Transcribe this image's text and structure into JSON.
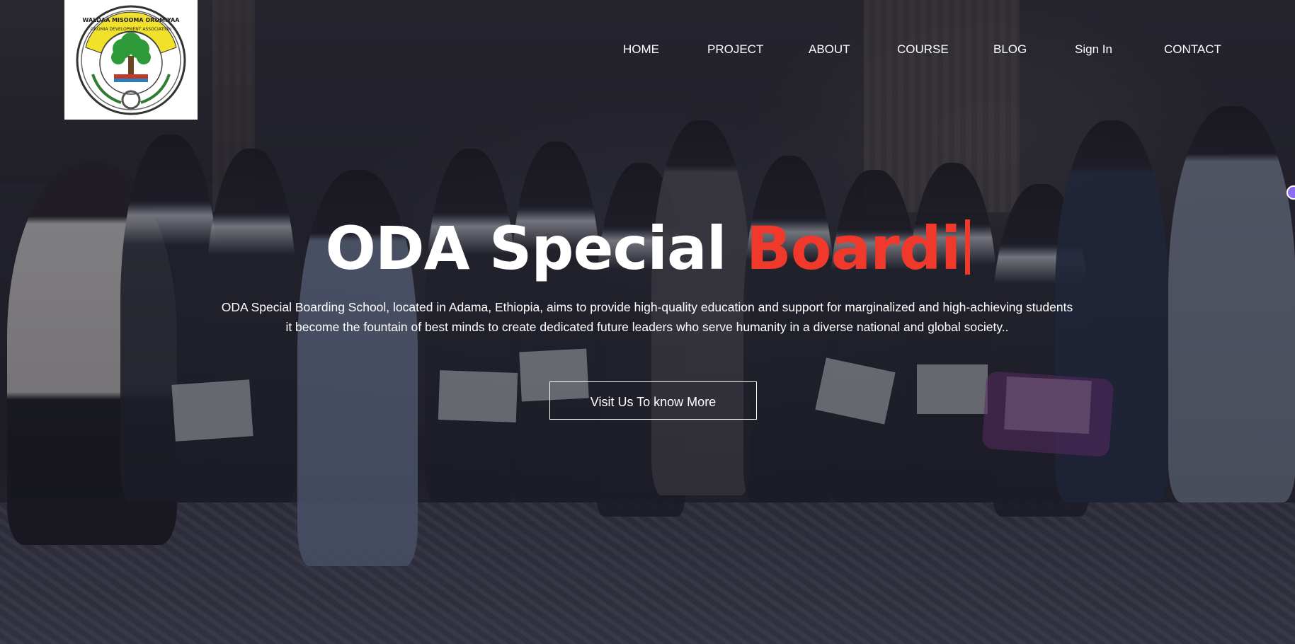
{
  "brand": {
    "logo_icon": "organization-emblem-icon",
    "logo_text_top": "WALDAA MISOOMA OROMIYAA",
    "logo_text_sub": "OROMIA DEVELOPMENT ASSOCIATION"
  },
  "nav": {
    "items": [
      {
        "label": "HOME"
      },
      {
        "label": "PROJECT"
      },
      {
        "label": "ABOUT"
      },
      {
        "label": "COURSE"
      },
      {
        "label": "BLOG"
      },
      {
        "label": "Sign In"
      },
      {
        "label": "CONTACT"
      }
    ]
  },
  "hero": {
    "headline_white": "ODA Special ",
    "headline_typed": "Boardi",
    "description_line1": "ODA Special Boarding School, located in Adama, Ethiopia, aims to provide high-quality education and support for marginalized and high-achieving students",
    "description_line2": "it become the fountain of best minds to create dedicated future leaders who serve humanity in a diverse national and global society..",
    "cta_label": "Visit Us To know More"
  },
  "colors": {
    "accent": "#f0392b",
    "text": "#ffffff",
    "overlay": "#141420"
  }
}
